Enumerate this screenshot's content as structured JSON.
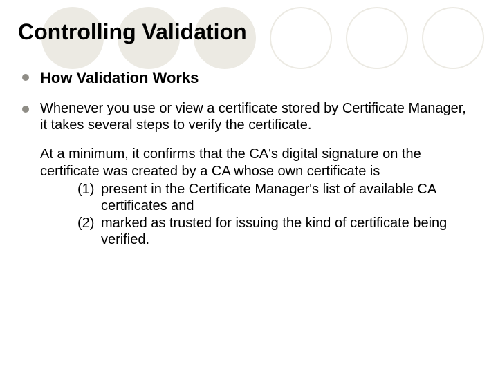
{
  "slide": {
    "title": "Controlling Validation",
    "subheading": "How Validation Works",
    "para1": "Whenever you use or view a certificate stored by Certificate Manager, it takes several steps to verify the certificate.",
    "para2_intro": "At a minimum, it confirms that the CA's digital signature on the certificate was created by a CA whose own certificate is",
    "item1_num": "(1)",
    "item1_text": "present in the Certificate Manager's list of available CA certificates and",
    "item2_num": "(2)",
    "item2_text": "marked as trusted for issuing the kind of certificate being verified."
  }
}
